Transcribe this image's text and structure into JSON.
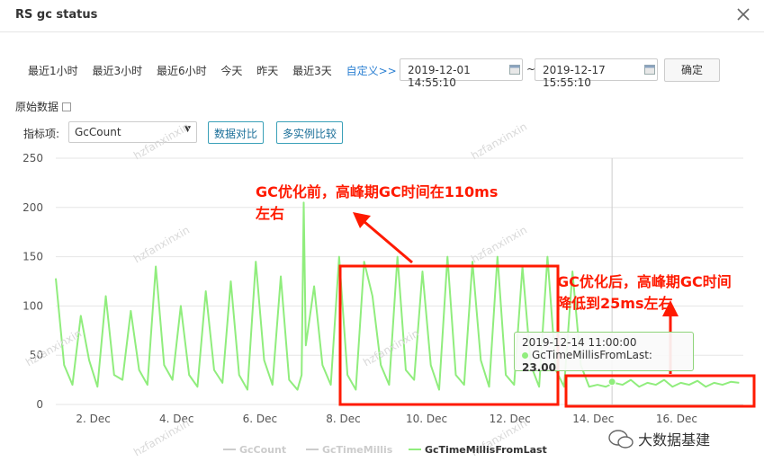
{
  "window": {
    "title": "RS gc status"
  },
  "time_ranges": [
    "最近1小时",
    "最近3小时",
    "最近6小时",
    "今天",
    "昨天",
    "最近3天"
  ],
  "custom_label": "自定义>>",
  "start_date": "2019-12-01 14:55:10",
  "end_date": "2019-12-17 15:55:10",
  "tilde": "~",
  "confirm_label": "确定",
  "raw_data_label": "原始数据",
  "metric": {
    "label": "指标项:",
    "selected": "GcCount"
  },
  "compare_data_label": "数据对比",
  "multi_instance_label": "多实例比较",
  "watermark": "hzfanxinxin",
  "annotations": {
    "before": [
      "GC优化前，高峰期GC时间在110ms",
      "左右"
    ],
    "after": [
      "GC优化后，高峰期GC时间",
      "降低到25ms左右"
    ]
  },
  "tooltip": {
    "time": "2019-12-14 11:00:00",
    "series": "GcTimeMillisFromLast:",
    "value": "23.00"
  },
  "wechat_label": "大数据基建",
  "colors": {
    "series": "#90ed7d",
    "annotation": "#ff1a00",
    "grid": "#e6e6e6"
  },
  "chart_data": {
    "type": "line",
    "ylim": [
      0,
      250
    ],
    "yticks": [
      0,
      50,
      100,
      150,
      200,
      250
    ],
    "xticks": [
      "2. Dec",
      "4. Dec",
      "6. Dec",
      "8. Dec",
      "10. Dec",
      "12. Dec",
      "14. Dec",
      "16. Dec"
    ],
    "xrange": [
      1.1,
      17.6
    ],
    "legend": [
      "GcCount",
      "GcTimeMillis",
      "GcTimeMillisFromLast"
    ],
    "legend_placement": "bottom",
    "series": [
      {
        "name": "GcTimeMillisFromLast",
        "x": [
          1.1,
          1.3,
          1.5,
          1.7,
          1.9,
          2.1,
          2.3,
          2.5,
          2.7,
          2.9,
          3.1,
          3.3,
          3.5,
          3.7,
          3.9,
          4.1,
          4.3,
          4.5,
          4.7,
          4.9,
          5.1,
          5.3,
          5.5,
          5.7,
          5.9,
          6.1,
          6.3,
          6.5,
          6.7,
          6.9,
          7.0,
          7.05,
          7.1,
          7.3,
          7.5,
          7.7,
          7.9,
          8.1,
          8.3,
          8.5,
          8.7,
          8.9,
          9.1,
          9.3,
          9.5,
          9.7,
          9.9,
          10.1,
          10.3,
          10.5,
          10.7,
          10.9,
          11.1,
          11.3,
          11.5,
          11.7,
          11.9,
          12.1,
          12.3,
          12.5,
          12.7,
          12.9,
          13.1,
          13.3,
          13.5,
          13.7,
          13.9,
          14.1,
          14.3,
          14.5,
          14.7,
          14.9,
          15.1,
          15.3,
          15.5,
          15.7,
          15.9,
          16.1,
          16.3,
          16.5,
          16.7,
          16.9,
          17.1,
          17.3,
          17.5
        ],
        "values": [
          128,
          40,
          20,
          90,
          45,
          18,
          110,
          30,
          25,
          95,
          35,
          20,
          140,
          40,
          25,
          100,
          30,
          18,
          115,
          35,
          22,
          125,
          30,
          15,
          145,
          45,
          20,
          130,
          25,
          15,
          30,
          205,
          60,
          120,
          40,
          20,
          150,
          30,
          15,
          145,
          110,
          40,
          20,
          150,
          35,
          25,
          135,
          40,
          15,
          150,
          30,
          20,
          145,
          45,
          18,
          150,
          30,
          20,
          140,
          40,
          18,
          150,
          35,
          18,
          135,
          40,
          18,
          20,
          18,
          22,
          20,
          25,
          18,
          22,
          20,
          25,
          18,
          22,
          20,
          24,
          18,
          22,
          20,
          23,
          22
        ]
      }
    ]
  }
}
